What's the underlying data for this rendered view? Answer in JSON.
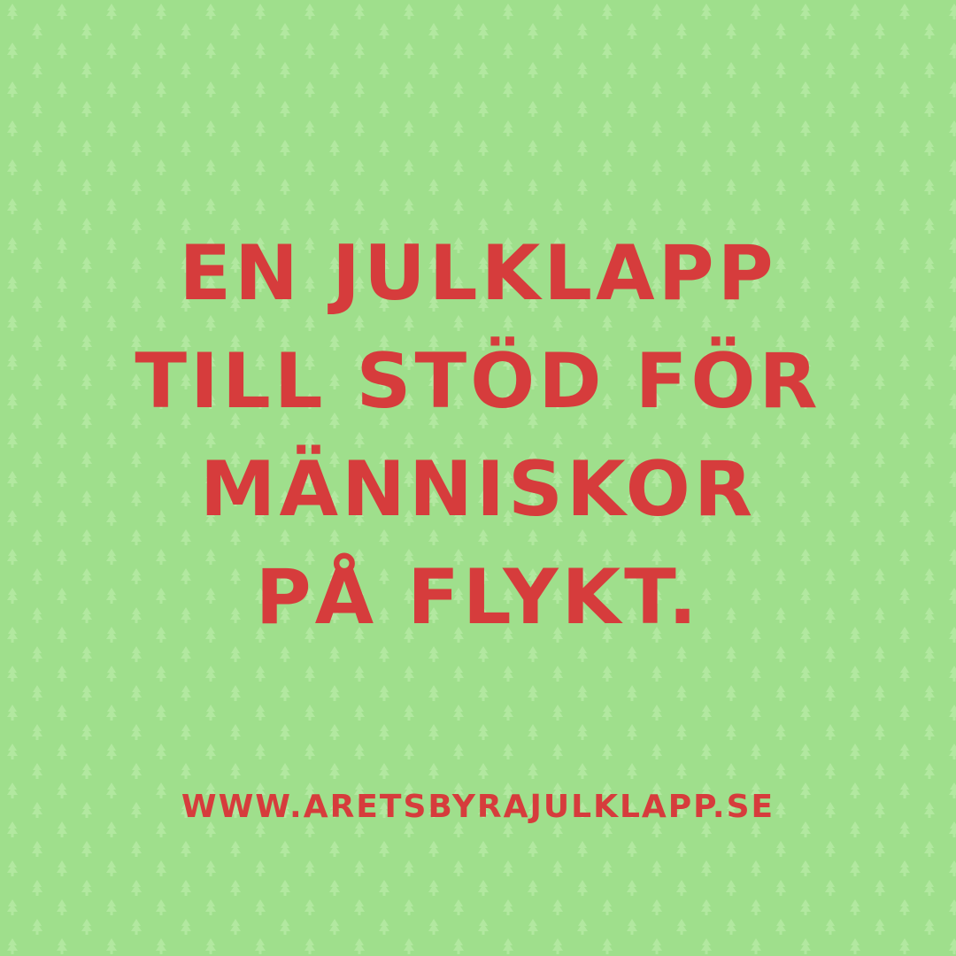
{
  "colors": {
    "background": "#9fdf8c",
    "pattern": "#b2e8a0",
    "text": "#d63c3c"
  },
  "background_icon": "christmas-tree-icon",
  "headline": {
    "lines": [
      "EN JULKLAPP",
      "TILL STÖD FÖR",
      "MÄNNISKOR",
      "PÅ FLYKT."
    ]
  },
  "website_url": "WWW.ARETSBYRAJULKLAPP.SE"
}
